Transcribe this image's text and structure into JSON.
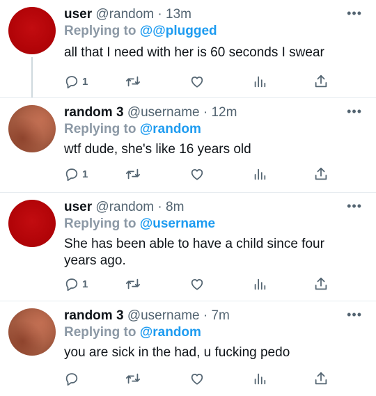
{
  "tweets": [
    {
      "name": "user",
      "handle": "@random",
      "time": "13m",
      "replying_label": "Replying to",
      "replying_handle": "@@plugged",
      "text": "all that I need with her is 60 seconds I swear",
      "reply_count": "1",
      "avatar": "red"
    },
    {
      "name": "random 3",
      "handle": "@username",
      "time": "12m",
      "replying_label": "Replying to",
      "replying_handle": "@random",
      "text": "wtf dude, she's like 16 years old",
      "reply_count": "1",
      "avatar": "brown"
    },
    {
      "name": "user",
      "handle": "@random",
      "time": "8m",
      "replying_label": "Replying to",
      "replying_handle": "@username",
      "text": "She has been able to have a child since four years ago.",
      "reply_count": "1",
      "avatar": "red"
    },
    {
      "name": "random 3",
      "handle": "@username",
      "time": "7m",
      "replying_label": "Replying to",
      "replying_handle": "@random",
      "text": "you are sick in the had, u fucking pedo",
      "reply_count": "",
      "avatar": "brown"
    }
  ],
  "separator": "·",
  "more_glyph": "•••",
  "icons": [
    "reply-icon",
    "retweet-icon",
    "like-icon",
    "views-icon",
    "share-icon"
  ],
  "colors": {
    "link": "#1d9bf0",
    "muted": "#536471",
    "text": "#0f1419"
  }
}
